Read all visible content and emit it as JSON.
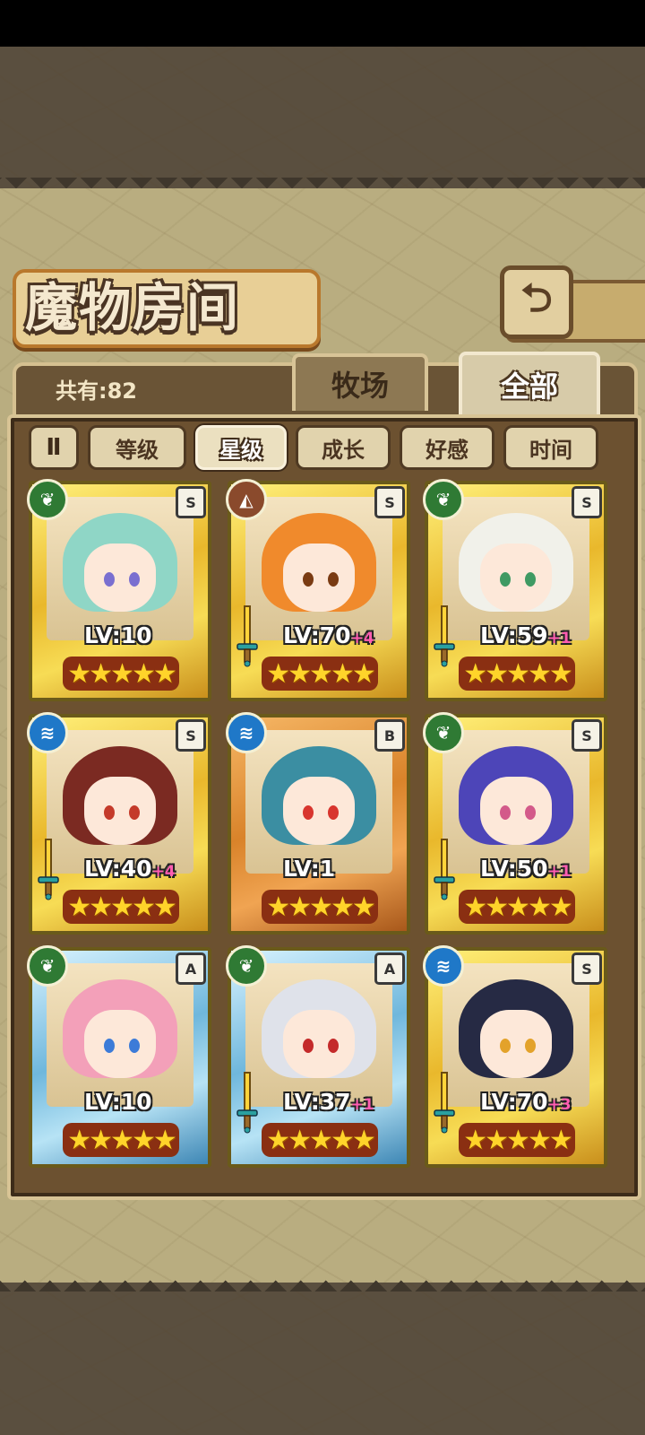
{
  "page": {
    "title": "魔物房间"
  },
  "header": {
    "count_text": "共有:82",
    "back_icon": "back-arrow-icon"
  },
  "tabs": [
    {
      "label": "牧场",
      "active": false
    },
    {
      "label": "全部",
      "active": true
    }
  ],
  "sort": {
    "order_icon": "sort-order-icon",
    "order_glyph": "Ⅱ",
    "options": [
      {
        "label": "等级",
        "active": false
      },
      {
        "label": "星级",
        "active": true
      },
      {
        "label": "成长",
        "active": false
      },
      {
        "label": "好感",
        "active": false
      },
      {
        "label": "时间",
        "active": false
      }
    ]
  },
  "monsters": [
    {
      "lv": "LV:10",
      "plus": "",
      "stars": 5,
      "grade": "S",
      "element": "leaf",
      "frame": "gold",
      "hair": "#8fd6c6",
      "eyes": "#7a6fd0",
      "has_sword": false
    },
    {
      "lv": "LV:70",
      "plus": "+4",
      "stars": 5,
      "grade": "S",
      "element": "earth",
      "frame": "gold",
      "hair": "#f08a2c",
      "eyes": "#7a3b12",
      "has_sword": true
    },
    {
      "lv": "LV:59",
      "plus": "+1",
      "stars": 5,
      "grade": "S",
      "element": "leaf",
      "frame": "gold",
      "hair": "#f1f1ea",
      "eyes": "#3f9a63",
      "has_sword": true
    },
    {
      "lv": "LV:40",
      "plus": "+4",
      "stars": 5,
      "grade": "S",
      "element": "water",
      "frame": "gold",
      "hair": "#7b2a22",
      "eyes": "#c43a2a",
      "has_sword": true
    },
    {
      "lv": "LV:1",
      "plus": "",
      "stars": 5,
      "grade": "B",
      "element": "water",
      "frame": "bronze",
      "hair": "#3b8ea2",
      "eyes": "#d8352e",
      "has_sword": false
    },
    {
      "lv": "LV:50",
      "plus": "+1",
      "stars": 5,
      "grade": "S",
      "element": "leaf",
      "frame": "gold",
      "hair": "#4d45b8",
      "eyes": "#d35a8a",
      "has_sword": true
    },
    {
      "lv": "LV:10",
      "plus": "",
      "stars": 5,
      "grade": "A",
      "element": "leaf",
      "frame": "silver",
      "hair": "#f3a0b9",
      "eyes": "#3c7bd8",
      "has_sword": false
    },
    {
      "lv": "LV:37",
      "plus": "+1",
      "stars": 5,
      "grade": "A",
      "element": "leaf",
      "frame": "silver",
      "hair": "#dfe2ea",
      "eyes": "#c42a2a",
      "has_sword": true
    },
    {
      "lv": "LV:70",
      "plus": "+3",
      "stars": 5,
      "grade": "S",
      "element": "water",
      "frame": "gold",
      "hair": "#262a44",
      "eyes": "#e3a22a",
      "has_sword": true
    }
  ],
  "colors": {
    "leaf": "#2f7a34",
    "water": "#1f78c8",
    "earth": "#8a4a2c"
  }
}
